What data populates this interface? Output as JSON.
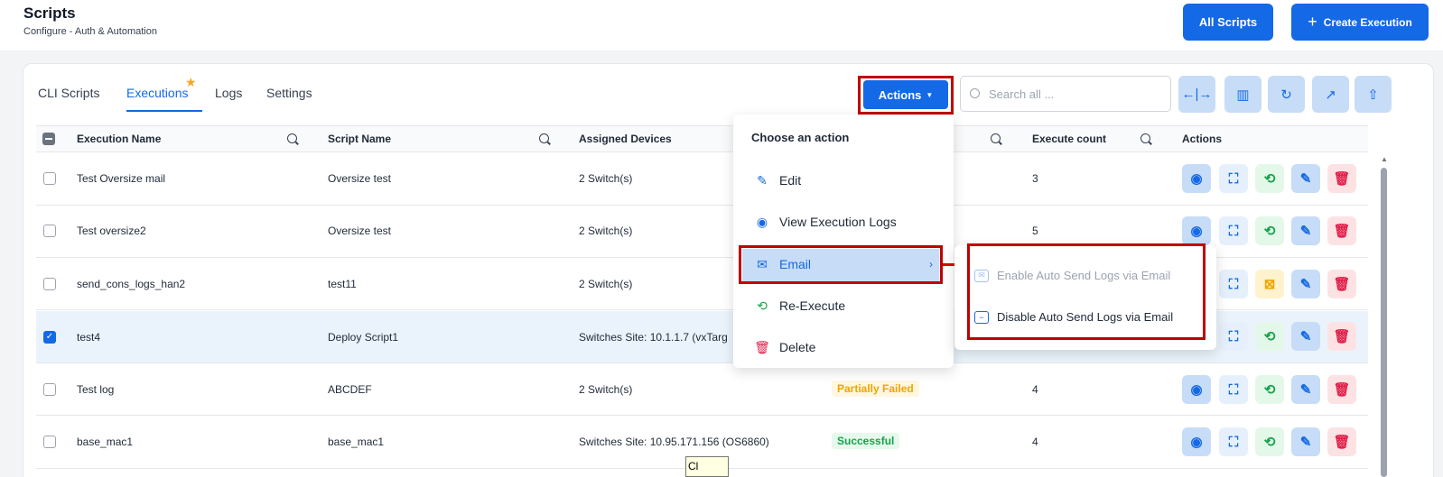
{
  "header": {
    "title": "Scripts",
    "breadcrumb": "Configure  -  Auth & Automation",
    "all_scripts_label": "All Scripts",
    "create_execution_label": "Create Execution"
  },
  "tabs": [
    {
      "label": "CLI Scripts",
      "active": false
    },
    {
      "label": "Executions",
      "active": true
    },
    {
      "label": "Logs",
      "active": false
    },
    {
      "label": "Settings",
      "active": false
    }
  ],
  "toolbar": {
    "actions_label": "Actions",
    "search_placeholder": "Search all ..."
  },
  "table": {
    "columns": [
      "Execution Name",
      "Script Name",
      "Assigned Devices",
      "Execute count",
      "Actions"
    ],
    "rows": [
      {
        "name": "Test Oversize mail",
        "script": "Oversize test",
        "devices": "2 Switch(s)",
        "status": "",
        "count": "3",
        "checked": false
      },
      {
        "name": "Test oversize2",
        "script": "Oversize test",
        "devices": "2 Switch(s)",
        "status": "",
        "count": "5",
        "checked": false
      },
      {
        "name": "send_cons_logs_han2",
        "script": "test11",
        "devices": "2 Switch(s)",
        "status": "",
        "count": "",
        "checked": false
      },
      {
        "name": "test4",
        "script": "Deploy Script1",
        "devices": "Switches Site: 10.1.1.7 (vxTarg",
        "status": "",
        "count": "",
        "checked": true
      },
      {
        "name": "Test log",
        "script": "ABCDEF",
        "devices": "2 Switch(s)",
        "status": "Partially Failed",
        "count": "4",
        "checked": false
      },
      {
        "name": "base_mac1",
        "script": "base_mac1",
        "devices": "Switches Site: 10.95.171.156 (OS6860)",
        "status": "Successful",
        "count": "4",
        "checked": false
      }
    ]
  },
  "actions_menu": {
    "title": "Choose an action",
    "items": [
      "Edit",
      "View Execution Logs",
      "Email",
      "Re-Execute",
      "Delete"
    ]
  },
  "email_submenu": {
    "items": [
      "Enable Auto Send Logs via Email",
      "Disable Auto Send Logs via Email"
    ]
  },
  "tooltip": "Cl"
}
